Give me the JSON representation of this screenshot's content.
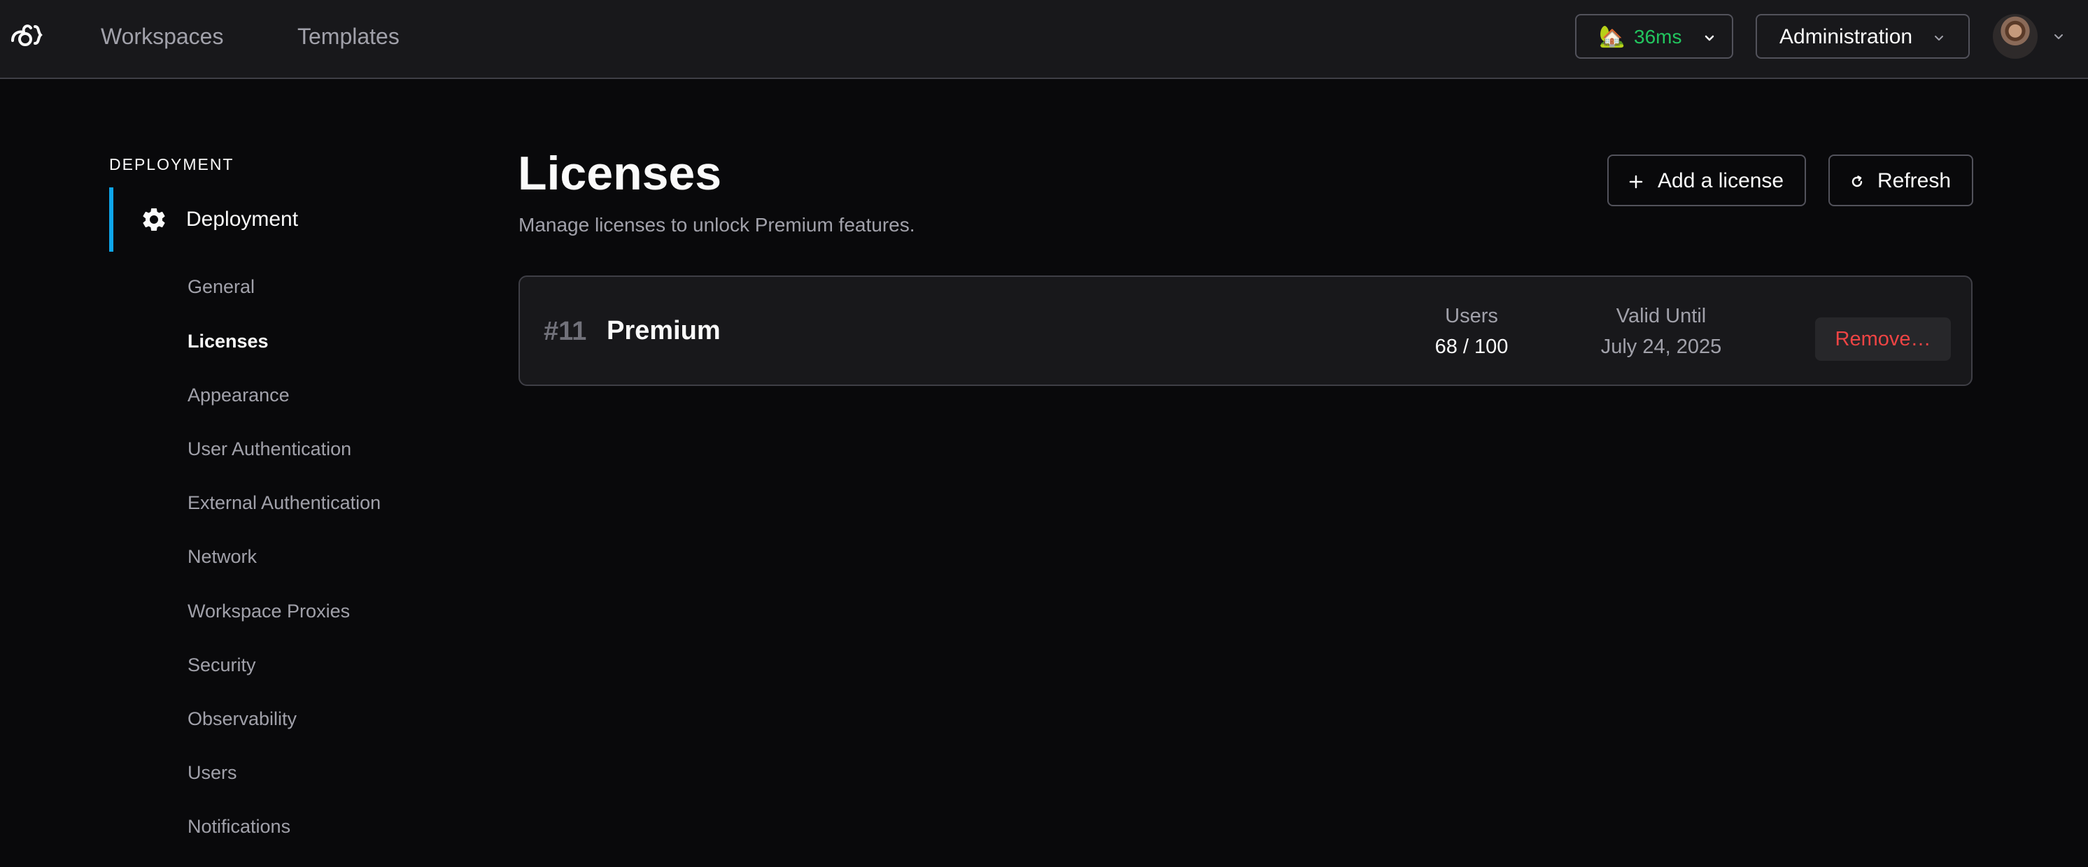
{
  "nav": {
    "logo_icon": "coder-logo-icon",
    "links": [
      "Workspaces",
      "Templates"
    ],
    "proxy": {
      "emoji": "🏡",
      "latency": "36ms",
      "latency_color": "#22c55e"
    },
    "admin_label": "Administration"
  },
  "sidebar": {
    "heading": "DEPLOYMENT",
    "active_section": {
      "icon": "gear-icon",
      "label": "Deployment",
      "accent": "#0ea5e9"
    },
    "items": [
      "General",
      "Licenses",
      "Appearance",
      "User Authentication",
      "External Authentication",
      "Network",
      "Workspace Proxies",
      "Security",
      "Observability",
      "Users",
      "Notifications"
    ],
    "selected_item": "Licenses"
  },
  "main": {
    "title": "Licenses",
    "subtitle": "Manage licenses to unlock Premium features.",
    "add_label": "Add a license",
    "refresh_label": "Refresh",
    "license": {
      "id": "#11",
      "name": "Premium",
      "users_label": "Users",
      "users_value": "68 / 100",
      "valid_label": "Valid Until",
      "valid_value": "July 24, 2025",
      "remove_label": "Remove…",
      "remove_color": "#ef4444"
    }
  }
}
